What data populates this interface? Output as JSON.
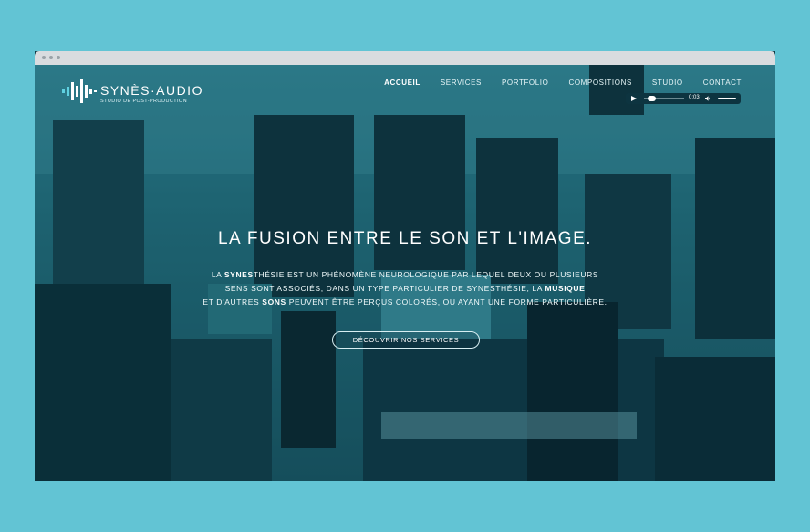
{
  "brand": {
    "name": "SYNÈS·AUDIO",
    "tagline": "STUDIO DE POST-PRODUCTION"
  },
  "nav": {
    "items": [
      {
        "label": "ACCUEIL",
        "active": true
      },
      {
        "label": "SERVICES",
        "active": false
      },
      {
        "label": "PORTFOLIO",
        "active": false
      },
      {
        "label": "COMPOSITIONS",
        "active": false
      },
      {
        "label": "STUDIO",
        "active": false
      },
      {
        "label": "CONTACT",
        "active": false
      }
    ]
  },
  "player": {
    "time": "0:03",
    "progress": 0.1,
    "volume": 1.0
  },
  "hero": {
    "title": "LA FUSION ENTRE LE SON ET L'IMAGE.",
    "line1_a": "LA ",
    "line1_b": "SYNES",
    "line1_c": "THÉSIE EST UN PHÉNOMÈNE NEUROLOGIQUE PAR LEQUEL DEUX OU PLUSIEURS",
    "line2_a": "SENS SONT ASSOCIÉS, DANS UN TYPE PARTICULIER DE SYNESTHÉSIE, LA ",
    "line2_b": "MUSIQUE",
    "line3_a": "ET D'AUTRES ",
    "line3_b": "SONS",
    "line3_c": " PEUVENT ÊTRE PERÇUS COLORÉS, OU AYANT UNE FORME PARTICULIÈRE.",
    "cta": "DÉCOUVRIR NOS SERVICES"
  },
  "colors": {
    "page_bg": "#62c4d4",
    "tint": "#2f8796",
    "player_bg": "#0d3440"
  }
}
